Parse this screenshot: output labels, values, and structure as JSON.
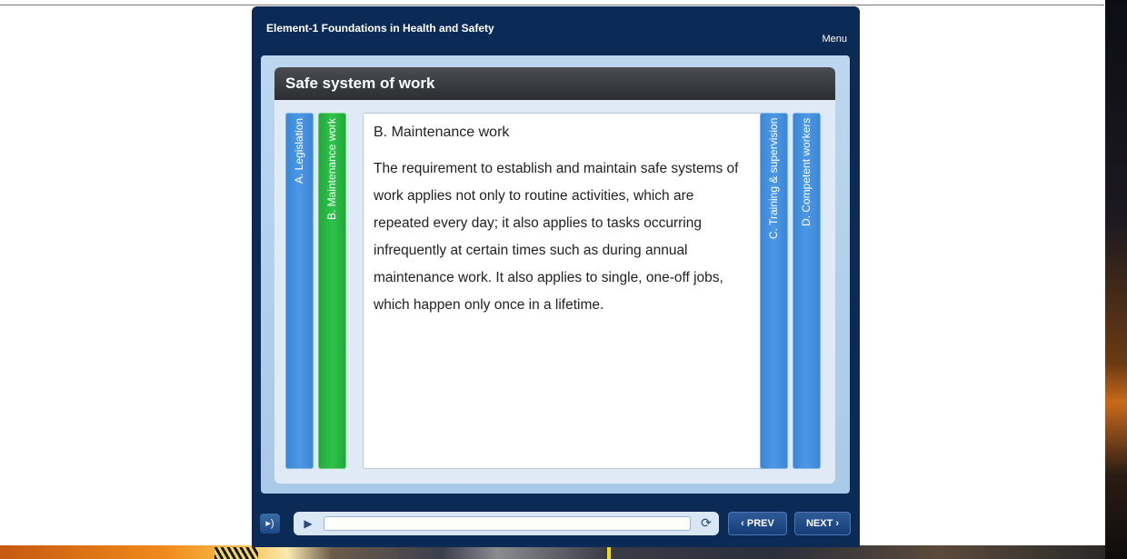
{
  "course": {
    "title": "Element-1 Foundations in Health and Safety",
    "menu_label": "Menu"
  },
  "slide": {
    "title": "Safe system of work",
    "tabs": [
      {
        "label": "A. Legislation",
        "state": "inactive",
        "color": "#3f8fdf"
      },
      {
        "label": "B. Maintenance work",
        "state": "active",
        "color": "#27b843"
      },
      {
        "label": "C. Training & supervision",
        "state": "inactive",
        "color": "#3f8fdf"
      },
      {
        "label": "D. Competent workers",
        "state": "inactive",
        "color": "#3f8fdf"
      }
    ],
    "content": {
      "heading": "B. Maintenance work",
      "body": "The requirement to establish and maintain safe systems of work applies not only to routine activities, which are repeated every day; it also applies to tasks occurring infrequently at certain times such as during annual maintenance work. It also applies to single, one-off jobs, which happen only once in a lifetime."
    }
  },
  "controls": {
    "volume_icon": "speaker-icon",
    "play_icon": "play-icon",
    "replay_icon": "replay-icon",
    "prev_label": "‹ PREV",
    "next_label": "NEXT ›"
  },
  "colors": {
    "frame": "#0c2a56",
    "header_bar": "#2b2d31",
    "accent_blue": "#3f8fdf",
    "accent_green": "#27b843"
  }
}
